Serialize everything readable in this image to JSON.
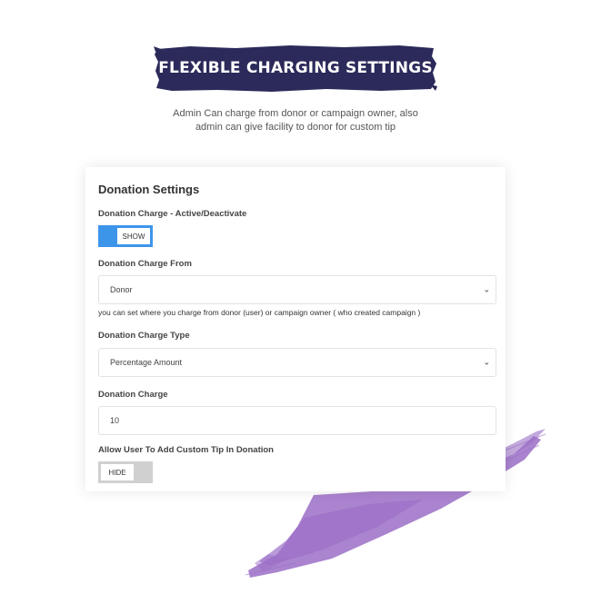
{
  "banner": {
    "title": "FLEXIBLE CHARGING SETTINGS",
    "color": "#2b2a5a"
  },
  "subtitle": {
    "line1": "Admin Can charge from donor or campaign owner, also",
    "line2": "admin can give facility to donor for custom tip"
  },
  "colors": {
    "brush": "#9b6fc7",
    "toggle_on": "#3d95ea",
    "toggle_off": "#d0d0d0"
  },
  "settings": {
    "title": "Donation Settings",
    "charge_active_label": "Donation Charge - Active/Deactivate",
    "charge_active_toggle": "SHOW",
    "charge_from_label": "Donation Charge From",
    "charge_from_value": "Donor",
    "charge_from_help": "you can set where you charge from donor (user) or campaign owner ( who created campaign )",
    "charge_type_label": "Donation Charge Type",
    "charge_type_value": "Percentage Amount",
    "charge_label": "Donation Charge",
    "charge_value": "10",
    "custom_tip_label": "Allow User To Add Custom Tip In Donation",
    "custom_tip_toggle": "HIDE"
  },
  "icons": {
    "select_chevron": "chevron-down-icon"
  }
}
